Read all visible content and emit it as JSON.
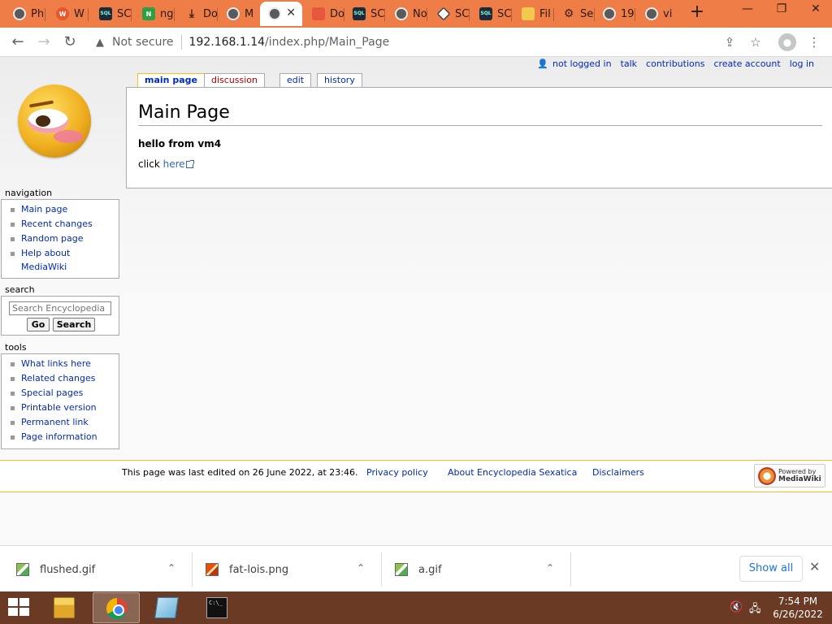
{
  "browser": {
    "tabs": [
      {
        "label": "Ph",
        "icon": "globe-icon"
      },
      {
        "label": "W",
        "icon": "w-icon"
      },
      {
        "label": "SC",
        "icon": "sql-icon"
      },
      {
        "label": "ng",
        "icon": "n-icon"
      },
      {
        "label": "Do",
        "icon": "download-icon"
      },
      {
        "label": "M",
        "icon": "globe-icon"
      },
      {
        "label": "",
        "icon": "globe-icon",
        "active": true
      },
      {
        "label": "Do",
        "icon": "doc-icon"
      },
      {
        "label": "SC",
        "icon": "sql-icon"
      },
      {
        "label": "No",
        "icon": "globe-icon"
      },
      {
        "label": "SC",
        "icon": "diamond-icon"
      },
      {
        "label": "SC",
        "icon": "sql-icon"
      },
      {
        "label": "Fil",
        "icon": "folder-icon"
      },
      {
        "label": "Se",
        "icon": "gear-icon"
      },
      {
        "label": "19",
        "icon": "globe-icon"
      },
      {
        "label": "vi",
        "icon": "globe-icon"
      }
    ],
    "new_tab": "+",
    "window_controls": {
      "minimize": "—",
      "restore": "❐",
      "close": "✕"
    },
    "address": {
      "security": "Not secure",
      "host": "192.168.1.14",
      "path": "/index.php/Main_Page"
    }
  },
  "wiki": {
    "personal": {
      "not_logged_in": "not logged in",
      "talk": "talk",
      "contributions": "contributions",
      "create_account": "create account",
      "log_in": "log in"
    },
    "content_tabs": {
      "main_page": "main page",
      "discussion": "discussion",
      "edit": "edit",
      "history": "history"
    },
    "page_title": "Main Page",
    "body_bold": "hello from vm4",
    "body_click": "click ",
    "body_link": "here",
    "navigation": {
      "title": "navigation",
      "items": [
        "Main page",
        "Recent changes",
        "Random page",
        "Help about MediaWiki"
      ]
    },
    "search": {
      "title": "search",
      "placeholder": "Search Encyclopedia",
      "go": "Go",
      "search": "Search"
    },
    "tools": {
      "title": "tools",
      "items": [
        "What links here",
        "Related changes",
        "Special pages",
        "Printable version",
        "Permanent link",
        "Page information"
      ]
    },
    "footer": {
      "last_modified": "This page was last edited on 26 June 2022, at 23:46.",
      "privacy": "Privacy policy",
      "about": "About Encyclopedia Sexatica",
      "disclaimers": "Disclaimers",
      "powered_line1": "Powered by",
      "powered_line2": "MediaWiki"
    }
  },
  "downloads": {
    "items": [
      {
        "name": "flushed.gif",
        "icon": "gif-file-icon"
      },
      {
        "name": "fat-lois.png",
        "icon": "png-file-icon"
      },
      {
        "name": "a.gif",
        "icon": "gif-file-icon"
      }
    ],
    "show_all": "Show all"
  },
  "taskbar": {
    "cmd_text": "C:\\_",
    "time": "7:54 PM",
    "date": "6/26/2022"
  },
  "colors": {
    "tab_strip": "#ee7d47",
    "taskbar": "#6b3a24",
    "link": "#002bb8",
    "new_link": "#ba0000",
    "tab_accent": "#fabd23"
  }
}
